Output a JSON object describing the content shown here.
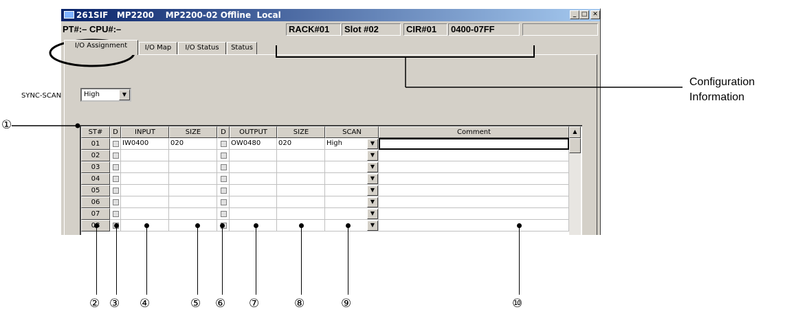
{
  "window": {
    "title": "261SIF   MP2200    MP2200-02 Offline  Local",
    "min_label": "_",
    "max_label": "□",
    "close_label": "✕"
  },
  "infobar": {
    "pt_cpu": "PT#:– CPU#:–",
    "rack": "RACK#01",
    "slot": "Slot #02",
    "cir": "CIR#01",
    "range": "0400-07FF",
    "extra": ""
  },
  "tabs": [
    "I/O Assignment",
    "I/O Map",
    "I/O Status",
    "Status"
  ],
  "sync_scan": {
    "label": "SYNC-SCAN",
    "value": "High",
    "arrow": "▼"
  },
  "grid": {
    "headers": [
      "ST#",
      "D",
      "INPUT",
      "SIZE",
      "D",
      "OUTPUT",
      "SIZE",
      "SCAN",
      "Comment"
    ],
    "rows": [
      {
        "st": "01",
        "input": "IW0400",
        "in_size": "020",
        "output": "OW0480",
        "out_size": "020",
        "scan": "High",
        "comment": ""
      },
      {
        "st": "02",
        "input": "",
        "in_size": "",
        "output": "",
        "out_size": "",
        "scan": "",
        "comment": ""
      },
      {
        "st": "03",
        "input": "",
        "in_size": "",
        "output": "",
        "out_size": "",
        "scan": "",
        "comment": ""
      },
      {
        "st": "04",
        "input": "",
        "in_size": "",
        "output": "",
        "out_size": "",
        "scan": "",
        "comment": ""
      },
      {
        "st": "05",
        "input": "",
        "in_size": "",
        "output": "",
        "out_size": "",
        "scan": "",
        "comment": ""
      },
      {
        "st": "06",
        "input": "",
        "in_size": "",
        "output": "",
        "out_size": "",
        "scan": "",
        "comment": ""
      },
      {
        "st": "07",
        "input": "",
        "in_size": "",
        "output": "",
        "out_size": "",
        "scan": "",
        "comment": ""
      },
      {
        "st": "08",
        "input": "",
        "in_size": "",
        "output": "",
        "out_size": "",
        "scan": "",
        "comment": ""
      }
    ],
    "dropdown_arrow": "▼",
    "scroll_up": "▲"
  },
  "annotations": {
    "numbers": [
      "①",
      "②",
      "③",
      "④",
      "⑤",
      "⑥",
      "⑦",
      "⑧",
      "⑨",
      "⑩"
    ],
    "config_line1": "Configuration",
    "config_line2": "Information"
  },
  "colors": {
    "titlebar_start": "#0a246a",
    "titlebar_end": "#a6caf0",
    "face": "#d4d0c8"
  }
}
